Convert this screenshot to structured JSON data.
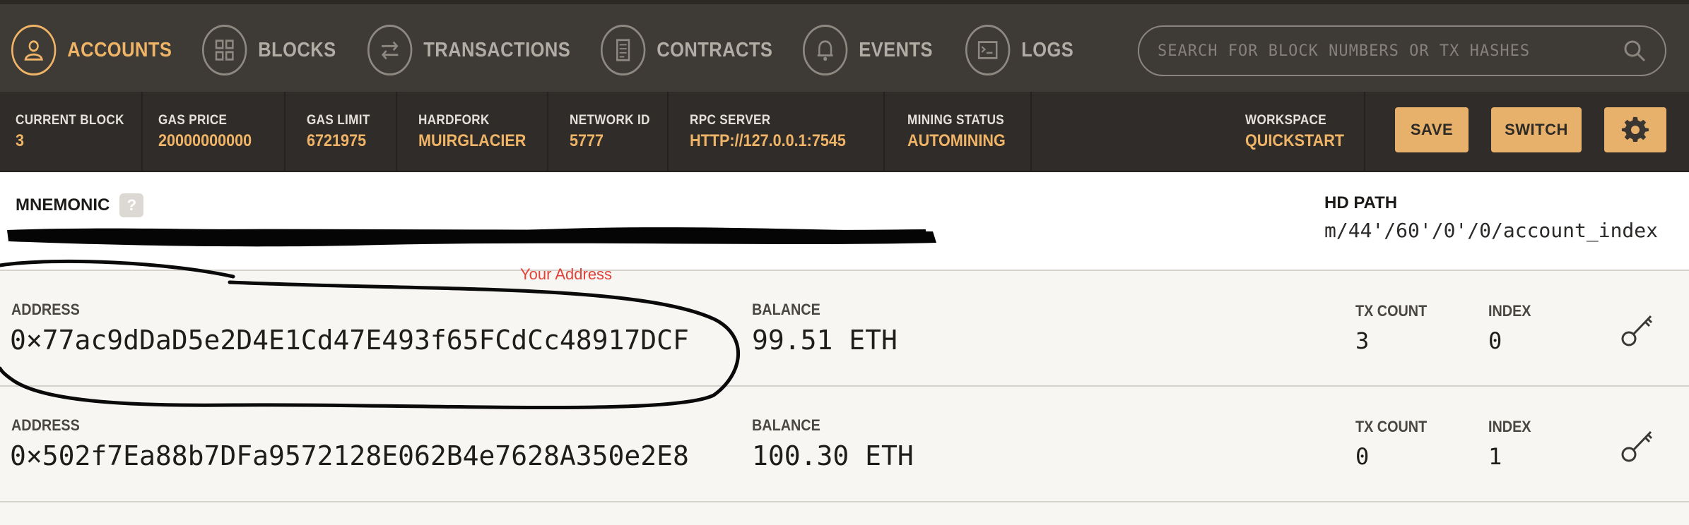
{
  "nav": {
    "items": [
      {
        "label": "ACCOUNTS",
        "icon": "person-icon",
        "active": true
      },
      {
        "label": "BLOCKS",
        "icon": "grid-icon",
        "active": false
      },
      {
        "label": "TRANSACTIONS",
        "icon": "arrows-swap-icon",
        "active": false
      },
      {
        "label": "CONTRACTS",
        "icon": "document-icon",
        "active": false
      },
      {
        "label": "EVENTS",
        "icon": "bell-icon",
        "active": false
      },
      {
        "label": "LOGS",
        "icon": "terminal-icon",
        "active": false
      }
    ],
    "search_placeholder": "SEARCH FOR BLOCK NUMBERS OR TX HASHES"
  },
  "status": {
    "current_block": {
      "label": "CURRENT BLOCK",
      "value": "3"
    },
    "gas_price": {
      "label": "GAS PRICE",
      "value": "20000000000"
    },
    "gas_limit": {
      "label": "GAS LIMIT",
      "value": "6721975"
    },
    "hardfork": {
      "label": "HARDFORK",
      "value": "MUIRGLACIER"
    },
    "network_id": {
      "label": "NETWORK ID",
      "value": "5777"
    },
    "rpc_server": {
      "label": "RPC SERVER",
      "value": "HTTP://127.0.0.1:7545"
    },
    "mining_status": {
      "label": "MINING STATUS",
      "value": "AUTOMINING"
    },
    "workspace": {
      "label": "WORKSPACE",
      "value": "QUICKSTART"
    },
    "save_label": "SAVE",
    "switch_label": "SWITCH"
  },
  "mnemonic": {
    "title": "MNEMONIC",
    "help": "?",
    "hd_path_title": "HD PATH",
    "hd_path": "m/44'/60'/0'/0/account_index"
  },
  "annotation": "Your Address",
  "accounts": [
    {
      "address_label": "ADDRESS",
      "address": "0×77ac9dDaD5e2D4E1Cd47E493f65FCdCc48917DCF",
      "balance_label": "BALANCE",
      "balance": "99.51 ETH",
      "tx_count_label": "TX COUNT",
      "tx_count": "3",
      "index_label": "INDEX",
      "index": "0"
    },
    {
      "address_label": "ADDRESS",
      "address": "0×502f7Ea88b7DFa9572128E062B4e7628A350e2E8",
      "balance_label": "BALANCE",
      "balance": "100.30 ETH",
      "tx_count_label": "TX COUNT",
      "tx_count": "0",
      "index_label": "INDEX",
      "index": "1"
    }
  ],
  "colors": {
    "accent": "#f0b467",
    "nav_bg": "#3e3a36",
    "status_bg": "#302c29",
    "button": "#e7b16b"
  }
}
